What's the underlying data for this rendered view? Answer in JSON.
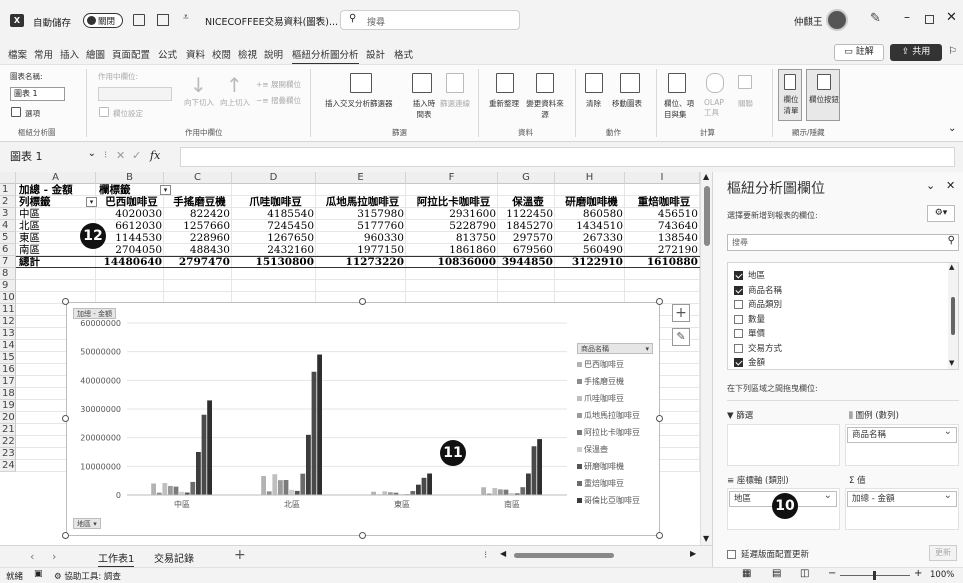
{
  "titlebar": {
    "autosave_label": "自動儲存",
    "autosave_state": "關閉",
    "doc_title": "NICECOFFEE交易資料(圖表)...",
    "search_placeholder": "搜尋",
    "user_name": "仲麒王"
  },
  "menu": {
    "items": [
      "檔案",
      "常用",
      "插入",
      "繪圖",
      "頁面配置",
      "公式",
      "資料",
      "校閱",
      "檢視",
      "說明",
      "樞紐分析圖分析",
      "設計",
      "格式"
    ],
    "active_index": 10,
    "comment_label": "註解",
    "share_label": "共用"
  },
  "ribbon": {
    "chart_name_label": "圖表名稱:",
    "chart_name_value": "圖表 1",
    "options_label": "選項",
    "group_chart": "樞紐分析圖",
    "active_field_label": "作用中欄位:",
    "field_settings_label": "欄位設定",
    "drill_down_label": "向下切入",
    "drill_up_label": "向上切入",
    "expand_label": "展開欄位",
    "collapse_label": "摺疊欄位",
    "group_active_field": "作用中欄位",
    "insert_slicer_label": "插入交叉分析篩選器",
    "insert_timeline_label": "插入時間表",
    "filter_connections_label": "篩選連線",
    "group_filter": "篩選",
    "refresh_label": "重新整理",
    "change_source_label": "變更資料來源",
    "group_data": "資料",
    "clear_label": "清除",
    "move_chart_label": "移動圖表",
    "group_actions": "動作",
    "fields_items_label": "欄位、項目與集",
    "olap_label": "OLAP工具",
    "relations_label": "關聯",
    "group_calc": "計算",
    "field_list_label": "欄位清單",
    "field_buttons_label": "欄位按鈕",
    "group_showhide": "顯示/隱藏"
  },
  "formula_bar": {
    "name_box": "圖表 1",
    "fx": "fx",
    "formula": ""
  },
  "sheet": {
    "columns": [
      "A",
      "B",
      "C",
      "D",
      "E",
      "F",
      "G",
      "H",
      "I"
    ],
    "rows": [
      [
        "加總 - 金額",
        "欄標籤",
        "",
        "",
        "",
        "",
        "",
        "",
        ""
      ],
      [
        "列標籤",
        "巴西咖啡豆",
        "手搖磨豆機",
        "爪哇咖啡豆",
        "瓜地馬拉咖啡豆",
        "阿拉比卡咖啡豆",
        "保溫壺",
        "研磨咖啡機",
        "重焙咖啡豆"
      ],
      [
        "中區",
        "4020030",
        "822420",
        "4185540",
        "3157980",
        "2931600",
        "1122450",
        "860580",
        "456510"
      ],
      [
        "北區",
        "6612030",
        "1257660",
        "7245450",
        "5177760",
        "5228790",
        "1845270",
        "1434510",
        "743640"
      ],
      [
        "東區",
        "1144530",
        "228960",
        "1267650",
        "960330",
        "813750",
        "297570",
        "267330",
        "138540"
      ],
      [
        "南區",
        "2704050",
        "488430",
        "2432160",
        "1977150",
        "1861860",
        "679560",
        "560490",
        "272190"
      ],
      [
        "總計",
        "14480640",
        "2797470",
        "15130800",
        "11273220",
        "10836000",
        "3944850",
        "3122910",
        "1610880"
      ]
    ],
    "row_numbers": [
      "1",
      "2",
      "3",
      "4",
      "5",
      "6",
      "7",
      "8",
      "9",
      "10",
      "11",
      "12",
      "13",
      "14",
      "15",
      "16",
      "17",
      "18",
      "19",
      "20",
      "21",
      "22",
      "23",
      "24"
    ]
  },
  "chart_data": {
    "type": "bar",
    "value_field_button": "加總 - 金額",
    "axis_field_button": "地區",
    "legend_title": "商品名稱",
    "categories": [
      "中區",
      "北區",
      "東區",
      "南區"
    ],
    "ylim": [
      0,
      60000000
    ],
    "yticks": [
      "0",
      "10000000",
      "20000000",
      "30000000",
      "40000000",
      "50000000",
      "60000000"
    ],
    "grid": true,
    "legend_position": "right",
    "series": [
      {
        "name": "巴西咖啡豆",
        "values": [
          4020030,
          6612030,
          1144530,
          2704050
        ],
        "color": "#b3b3b3"
      },
      {
        "name": "手搖磨豆機",
        "values": [
          822420,
          1257660,
          228960,
          488430
        ],
        "color": "#8c8c8c"
      },
      {
        "name": "爪哇咖啡豆",
        "values": [
          4185540,
          7245450,
          1267650,
          2432160
        ],
        "color": "#bfbfbf"
      },
      {
        "name": "瓜地馬拉咖啡豆",
        "values": [
          3157980,
          5177760,
          960330,
          1977150
        ],
        "color": "#9a9a9a"
      },
      {
        "name": "阿拉比卡咖啡豆",
        "values": [
          2931600,
          5228790,
          813750,
          1861860
        ],
        "color": "#7a7a7a"
      },
      {
        "name": "保溫壺",
        "values": [
          1122450,
          1845270,
          297570,
          679560
        ],
        "color": "#cfcfcf"
      },
      {
        "name": "研磨咖啡機",
        "values": [
          860580,
          1434510,
          267330,
          560490
        ],
        "color": "#555555"
      },
      {
        "name": "重焙咖啡豆",
        "values": [
          4565100,
          7436400,
          1385400,
          2721900
        ],
        "color": "#6b6b6b"
      },
      {
        "name": "哥倫比亞咖啡豆",
        "values": [
          15000000,
          21000000,
          3600000,
          7500000
        ],
        "color": "#3c3c3c"
      }
    ],
    "extra_bars": [
      {
        "name": "group-high",
        "values": [
          28000000,
          43000000,
          6000000,
          17000000
        ],
        "color": "#4a4a4a"
      },
      {
        "name": "group-top",
        "values": [
          33000000,
          49000000,
          7500000,
          19500000
        ],
        "color": "#2e2e2e"
      }
    ]
  },
  "badges": {
    "chart": "11",
    "sheet": "12",
    "pane": "10"
  },
  "pane": {
    "title": "樞紐分析圖欄位",
    "subtitle": "選擇要新增到報表的欄位:",
    "search_placeholder": "搜尋",
    "fields": [
      {
        "label": "地區",
        "checked": true
      },
      {
        "label": "商品名稱",
        "checked": true
      },
      {
        "label": "商品類別",
        "checked": false
      },
      {
        "label": "數量",
        "checked": false
      },
      {
        "label": "單價",
        "checked": false
      },
      {
        "label": "交易方式",
        "checked": false
      },
      {
        "label": "金額",
        "checked": true
      }
    ],
    "drag_label": "在下列區域之間拖曳欄位:",
    "filter_label": "篩選",
    "legend_label": "圖例 (數列)",
    "legend_value": "商品名稱",
    "axis_label": "座標軸 (類別)",
    "axis_value": "地區",
    "values_label": "值",
    "values_value": "加總 - 金額",
    "defer_label": "延遲版面配置更新",
    "update_label": "更新"
  },
  "tabs": {
    "sheets": [
      "工作表1",
      "交易記錄"
    ],
    "active": 0,
    "add": "+"
  },
  "status": {
    "ready": "就緒",
    "accessibility": "協助工具: 調查",
    "zoom": "100%"
  }
}
